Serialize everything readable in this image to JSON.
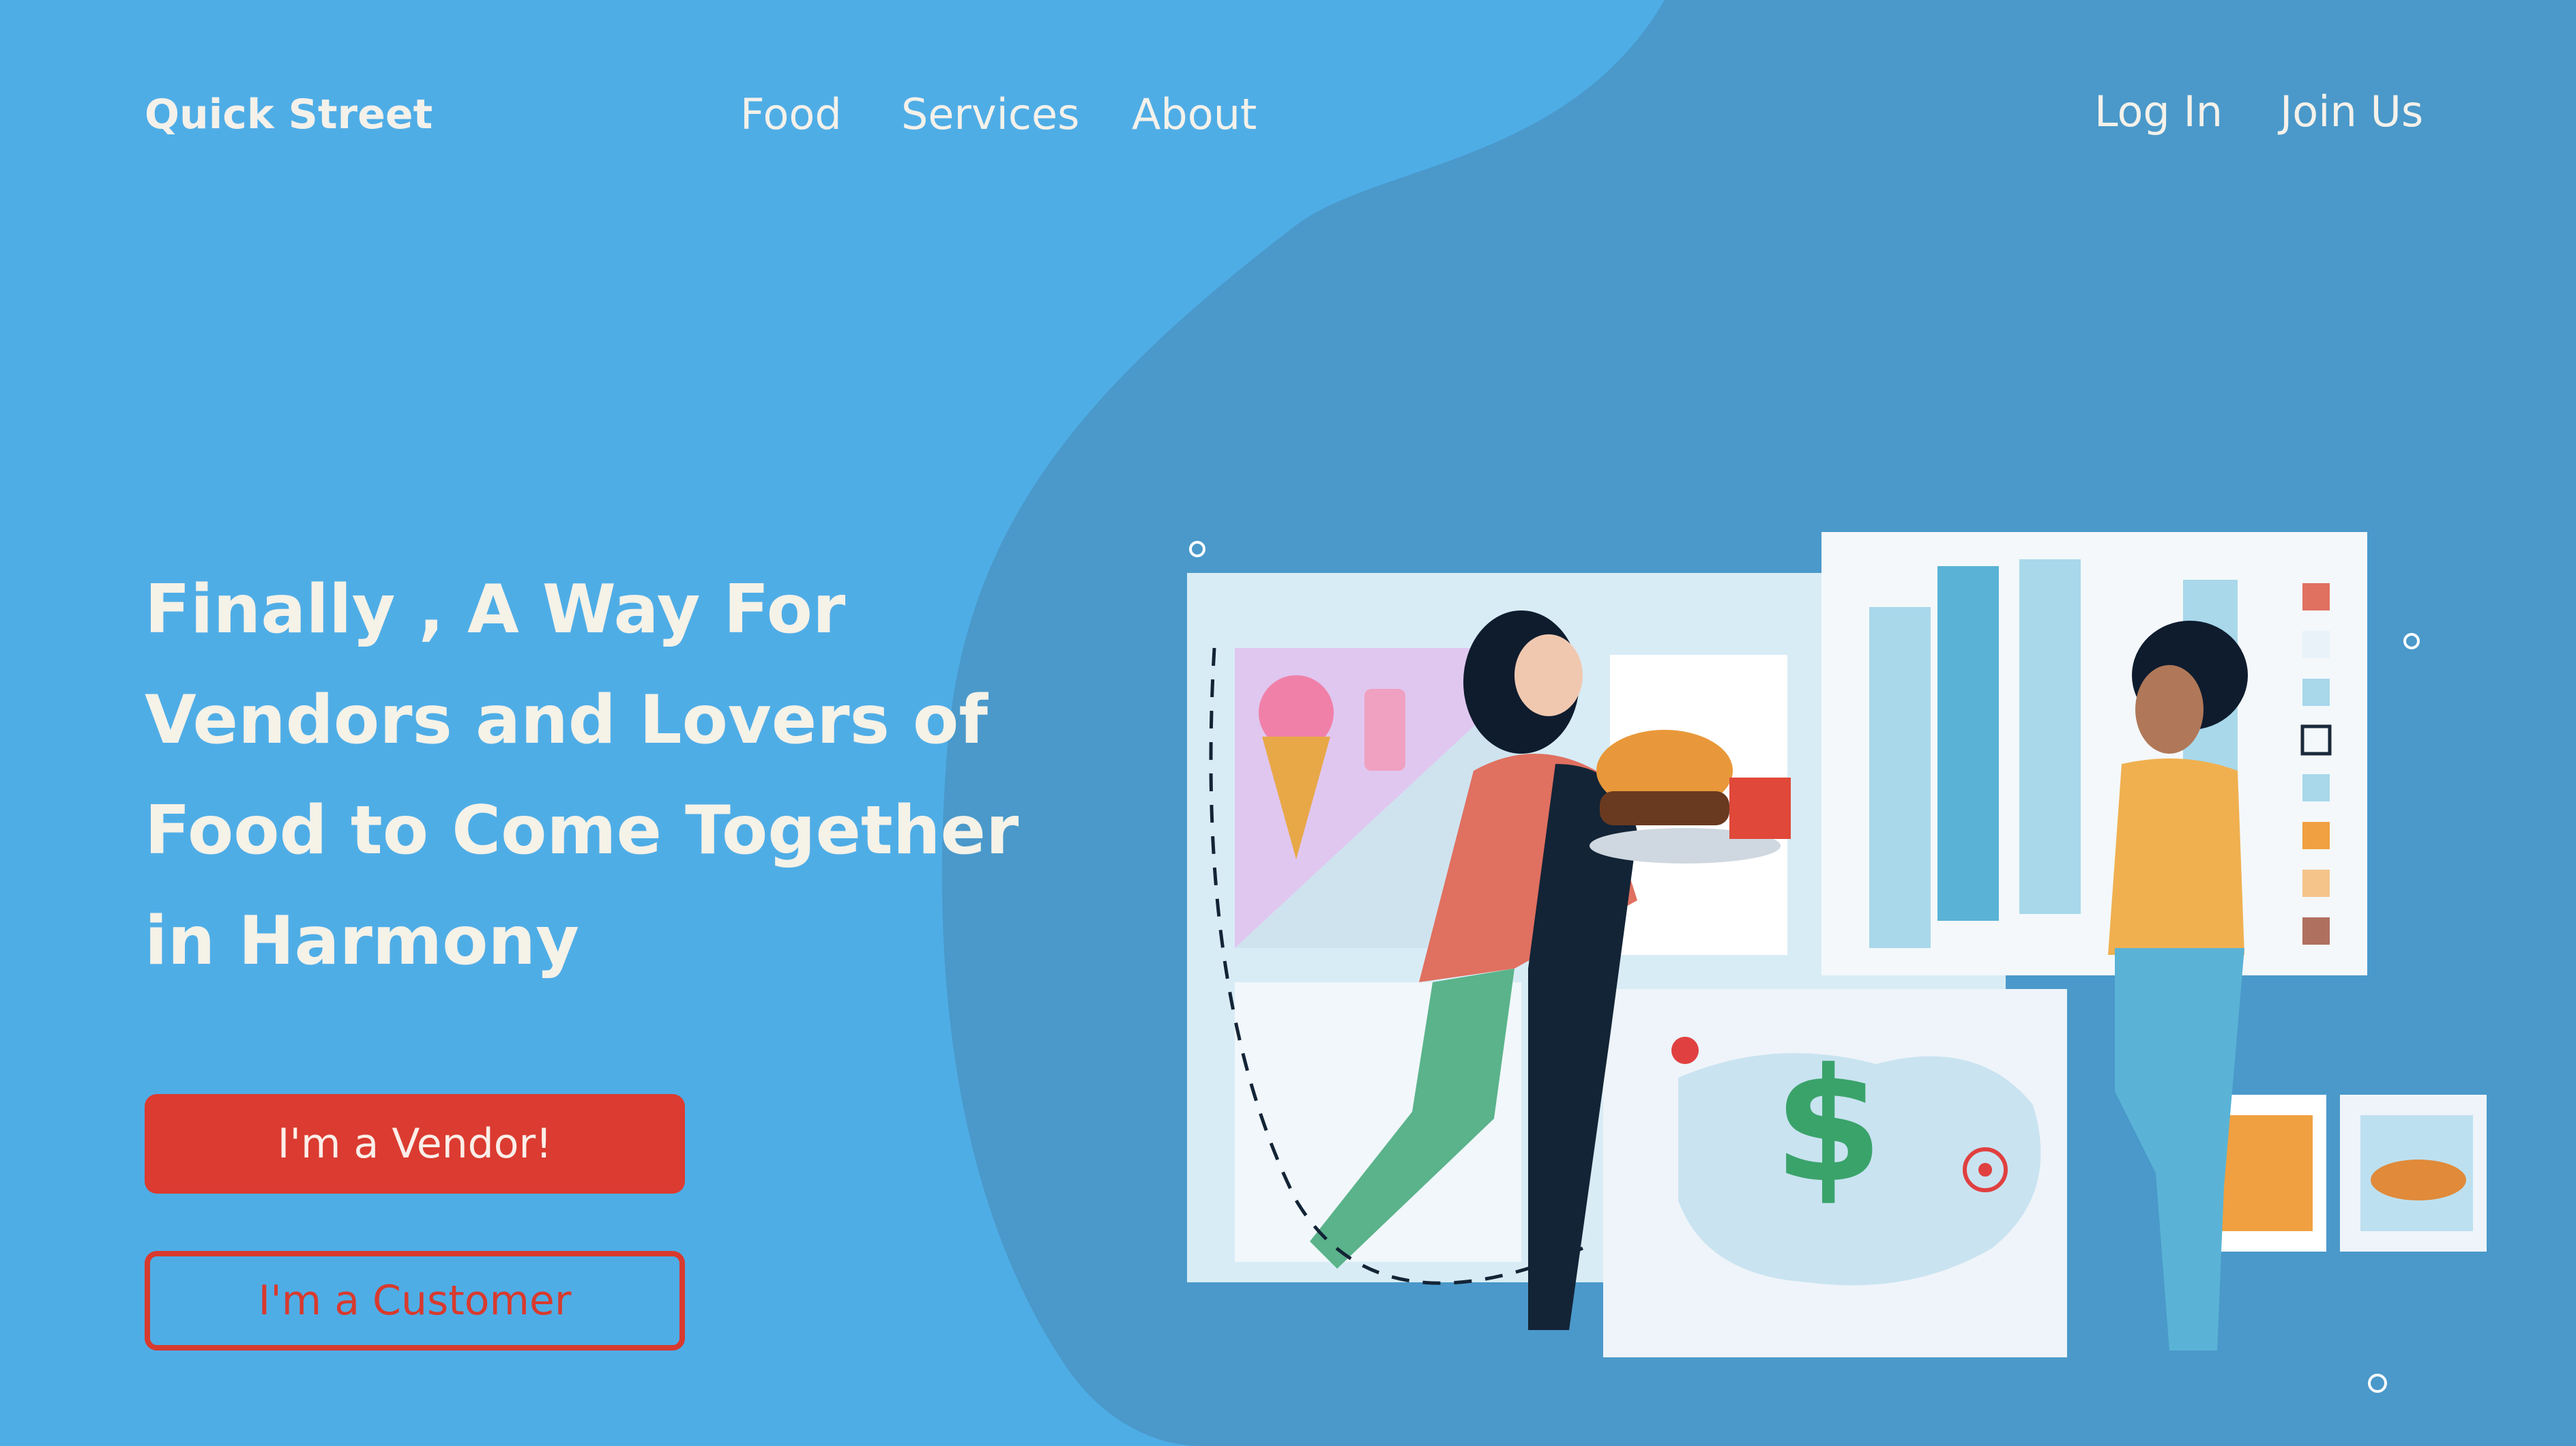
{
  "header": {
    "brand": "Quick Street",
    "nav": [
      {
        "label": "Food"
      },
      {
        "label": "Services"
      },
      {
        "label": "About"
      }
    ],
    "auth": {
      "login": "Log In",
      "join": "Join Us"
    }
  },
  "hero": {
    "headline_lines": [
      "Finally , A Way For",
      "Vendors and Lovers of",
      "Food to Come  Together",
      "in Harmony"
    ],
    "vendor_button": "I'm a Vendor!",
    "customer_button": "I'm a Customer"
  },
  "illustration": {
    "currency_symbol": "$"
  },
  "colors": {
    "background": "#4fade6",
    "blob": "#4a99ca",
    "accent_red": "#db3b30",
    "text_light": "#f5f2e8"
  }
}
